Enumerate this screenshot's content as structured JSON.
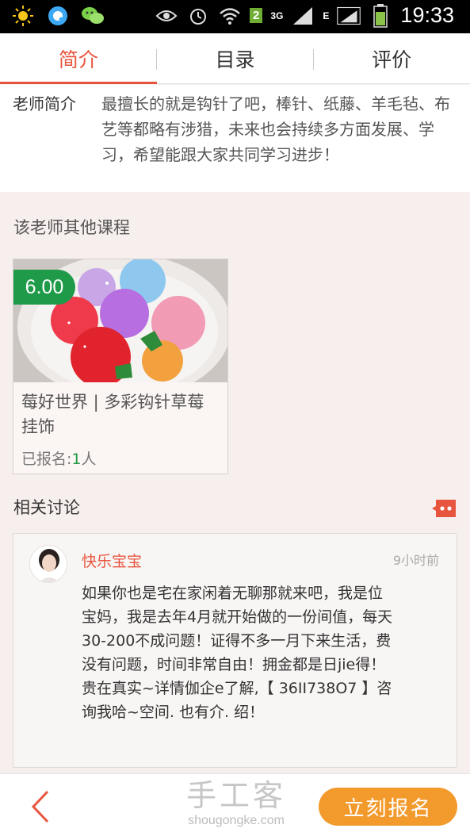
{
  "status_bar": {
    "time": "19:33",
    "network_label": "3G",
    "edge_label": "E",
    "notification_count": "2",
    "icons": [
      "weather-sun-icon",
      "qq-icon",
      "wechat-icon",
      "eye-icon",
      "alarm-icon",
      "wifi-icon",
      "signal-icon",
      "battery-icon"
    ]
  },
  "tabs": [
    {
      "label": "简介",
      "active": true
    },
    {
      "label": "目录",
      "active": false
    },
    {
      "label": "评价",
      "active": false
    }
  ],
  "teacher_intro": {
    "label": "老师简介",
    "text": "最擅长的就是钩针了吧，棒针、纸藤、羊毛毡、布艺等都略有涉猎，未来也会持续多方面发展、学习，希望能跟大家共同学习进步！"
  },
  "other_courses": {
    "title": "该老师其他课程",
    "courses": [
      {
        "price": "6.00",
        "name": "莓好世界 | 多彩钩针草莓挂饰",
        "enroll_label": "已报名:",
        "enroll_count": "1",
        "enroll_unit": "人"
      }
    ]
  },
  "discussion": {
    "title": "相关讨论",
    "items": [
      {
        "username": "快乐宝宝",
        "time": "9小时前",
        "text": "如果你也是宅在家闲着无聊那就来吧，我是位宝妈，我是去年4月就开始做的一份间值，每天30-200不成问题！证得不多一月下来生活，费没有问题，时间非常自由！拥金都是日jie得！贵在真实~详情伽企e了解,【 36II738O7 】咨询我哈~空间. 也有介. 绍！"
      }
    ]
  },
  "bottom_bar": {
    "watermark_cn": "手工客",
    "watermark_url": "shougongke.com",
    "signup_label": "立刻报名"
  },
  "colors": {
    "accent": "#e8553e",
    "price_green": "#1f9a48",
    "signup_orange": "#f39a2d",
    "page_bg": "#f7efed"
  }
}
